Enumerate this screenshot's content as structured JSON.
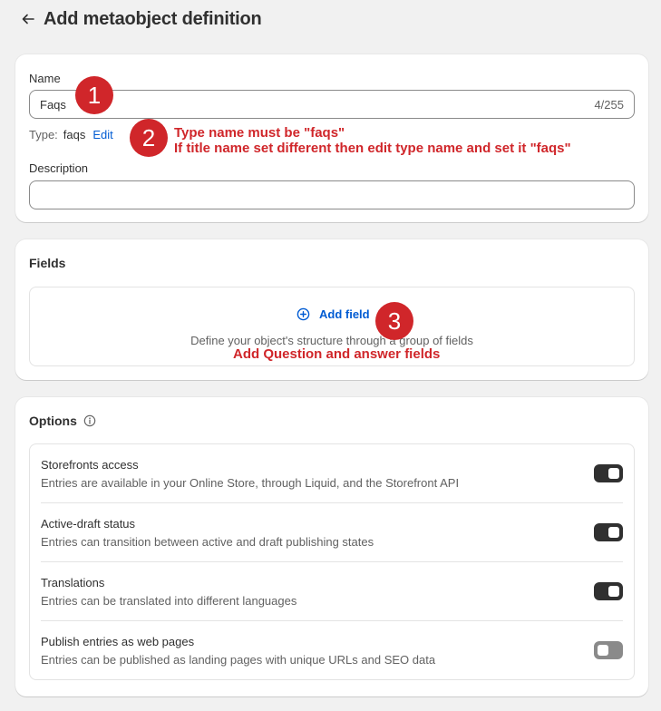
{
  "header": {
    "title": "Add metaobject definition",
    "back_icon": "arrow-left-icon"
  },
  "name_section": {
    "name_label": "Name",
    "name_value": "Faqs",
    "char_count": "4/255",
    "type_label": "Type:",
    "type_value": "faqs",
    "edit_label": "Edit",
    "description_label": "Description",
    "description_value": ""
  },
  "fields_section": {
    "title": "Fields",
    "add_field_label": "Add field",
    "add_icon": "plus-circle-icon",
    "empty_description": "Define your object's structure through a group of fields"
  },
  "options_section": {
    "title": "Options",
    "info_icon": "info-icon",
    "items": [
      {
        "title": "Storefronts access",
        "description": "Entries are available in your Online Store, through Liquid, and the Storefront API",
        "enabled": true
      },
      {
        "title": "Active-draft status",
        "description": "Entries can transition between active and draft publishing states",
        "enabled": true
      },
      {
        "title": "Translations",
        "description": "Entries can be translated into different languages",
        "enabled": true
      },
      {
        "title": "Publish entries as web pages",
        "description": "Entries can be published as landing pages with unique URLs and SEO data",
        "enabled": false
      }
    ]
  },
  "annotations": {
    "badges": [
      "1",
      "2",
      "3"
    ],
    "note_2_line1": "Type name must be \"faqs\"",
    "note_2_line2": "If title name set different then edit type name and set it \"faqs\"",
    "note_3": "Add Question and answer fields"
  },
  "colors": {
    "accent": "#005bd3",
    "annotation": "#d0262a",
    "toggle_on": "#303030",
    "toggle_off": "#8a8a8a"
  }
}
